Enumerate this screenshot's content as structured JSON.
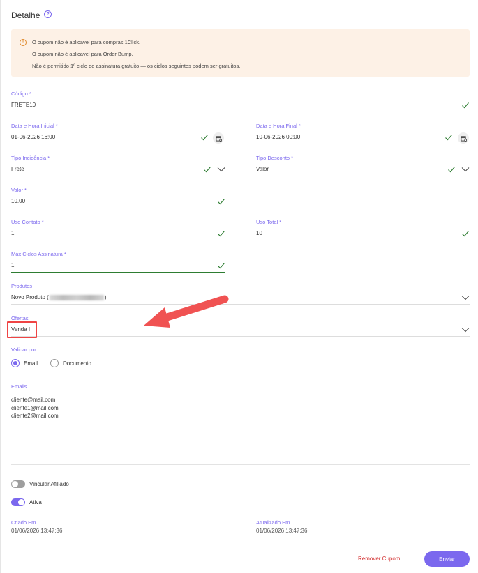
{
  "header": {
    "title": "Detalhe",
    "help_icon": "question-circle-icon"
  },
  "alert": {
    "icon": "warning-circle-icon",
    "lines": [
      "O cupom não é aplicavel para compras 1Click.",
      "O cupom não é aplicavel para Order Bump.",
      "Não é permitido 1º ciclo de assinatura gratuito — os ciclos seguintes podem ser gratuitos."
    ]
  },
  "fields": {
    "codigo": {
      "label": "Código *",
      "value": "FRETE10"
    },
    "data_inicial": {
      "label": "Data e Hora Inicial *",
      "value": "01-06-2026 16:00"
    },
    "data_final": {
      "label": "Data e Hora Final *",
      "value": "10-06-2026 00:00"
    },
    "tipo_incidencia": {
      "label": "Tipo Incidência *",
      "value": "Frete"
    },
    "tipo_desconto": {
      "label": "Tipo Desconto *",
      "value": "Valor"
    },
    "valor": {
      "label": "Valor *",
      "value": "10.00"
    },
    "uso_contato": {
      "label": "Uso Contato *",
      "value": "1"
    },
    "uso_total": {
      "label": "Uso Total *",
      "value": "10"
    },
    "max_ciclos": {
      "label": "Máx Ciclos Assinatura *",
      "value": "1"
    },
    "produtos": {
      "label": "Produtos",
      "value_prefix": "Novo Produto (",
      "value_suffix": ")"
    },
    "ofertas": {
      "label": "Ofertas",
      "value": "Venda I"
    }
  },
  "validar": {
    "label": "Validar por:",
    "options": [
      {
        "label": "Email",
        "selected": true
      },
      {
        "label": "Documento",
        "selected": false
      }
    ]
  },
  "emails": {
    "label": "Emails",
    "list": [
      "cliente@mail.com",
      "cliente1@mail.com",
      "cliente2@mail.com"
    ]
  },
  "toggles": {
    "vincular": {
      "label": "Vincular Afiliado",
      "on": false
    },
    "ativa": {
      "label": "Ativa",
      "on": true
    }
  },
  "meta": {
    "criado": {
      "label": "Criado Em",
      "value": "01/06/2026 13:47:36"
    },
    "atualizado": {
      "label": "Atualizado Em",
      "value": "01/06/2026 13:47:36"
    }
  },
  "actions": {
    "remove_label": "Remover Cupom",
    "submit_label": "Enviar"
  },
  "colors": {
    "accent": "#7b68ee",
    "valid": "#2e7d32",
    "danger": "#d32f2f",
    "alert_bg": "#fdf1e6",
    "annotation": "#ef4444"
  }
}
